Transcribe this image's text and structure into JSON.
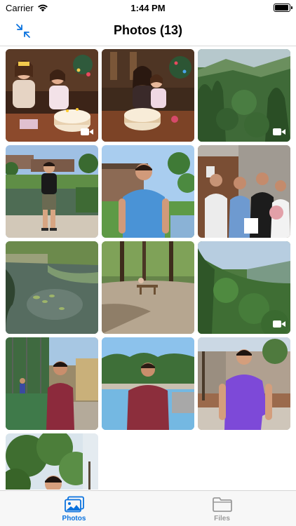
{
  "status_bar": {
    "carrier": "Carrier",
    "time": "1:44 PM",
    "battery_level": 0.95
  },
  "nav": {
    "title": "Photos (13)",
    "left_icon": "collapse-arrows-icon"
  },
  "photos": [
    {
      "id": 1,
      "kind": "video",
      "subject": "two girls with birthday cake",
      "icon": "video-camera-icon"
    },
    {
      "id": 2,
      "kind": "photo",
      "subject": "woman and child with cake"
    },
    {
      "id": 3,
      "kind": "video",
      "subject": "forested mountain valley",
      "icon": "video-camera-icon"
    },
    {
      "id": 4,
      "kind": "photo",
      "subject": "man by garden pond"
    },
    {
      "id": 5,
      "kind": "photo",
      "subject": "man in blue shirt by trees"
    },
    {
      "id": 6,
      "kind": "photo",
      "subject": "group selfie in elevator"
    },
    {
      "id": 7,
      "kind": "photo",
      "subject": "pond with lily pads"
    },
    {
      "id": 8,
      "kind": "photo",
      "subject": "forest clearing with table"
    },
    {
      "id": 9,
      "kind": "video",
      "subject": "green hillside forest",
      "icon": "video-camera-icon"
    },
    {
      "id": 10,
      "kind": "photo",
      "subject": "man by sports field"
    },
    {
      "id": 11,
      "kind": "photo",
      "subject": "man by swimming pool"
    },
    {
      "id": 12,
      "kind": "photo",
      "subject": "man in purple shirt outdoors"
    },
    {
      "id": 13,
      "kind": "photo",
      "subject": "man among trees"
    }
  ],
  "tabs": [
    {
      "label": "Photos",
      "icon": "photos-icon",
      "active": true
    },
    {
      "label": "Files",
      "icon": "folder-icon",
      "active": false
    }
  ],
  "colors": {
    "accent": "#0a72de",
    "inactive": "#9a9a9a",
    "tab_bar_bg": "#f7f7f7"
  }
}
